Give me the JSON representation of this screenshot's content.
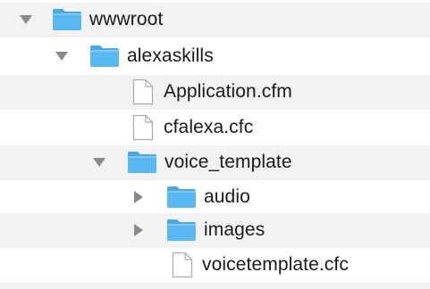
{
  "tree": {
    "items": [
      {
        "label": "wwwroot",
        "kind": "folder",
        "depth": 0,
        "expanded": true,
        "icon": "folder-icon",
        "arrow": "disclosure-expanded-icon"
      },
      {
        "label": "alexaskills",
        "kind": "folder",
        "depth": 1,
        "expanded": true,
        "icon": "folder-icon",
        "arrow": "disclosure-expanded-icon"
      },
      {
        "label": "Application.cfm",
        "kind": "file",
        "depth": 2,
        "icon": "document-icon"
      },
      {
        "label": "cfalexa.cfc",
        "kind": "file",
        "depth": 2,
        "icon": "document-icon"
      },
      {
        "label": "voice_template",
        "kind": "folder",
        "depth": 2,
        "expanded": true,
        "icon": "folder-icon",
        "arrow": "disclosure-expanded-icon"
      },
      {
        "label": "audio",
        "kind": "folder",
        "depth": 3,
        "expanded": false,
        "icon": "folder-icon",
        "arrow": "disclosure-collapsed-icon"
      },
      {
        "label": "images",
        "kind": "folder",
        "depth": 3,
        "expanded": false,
        "icon": "folder-icon",
        "arrow": "disclosure-collapsed-icon"
      },
      {
        "label": "voicetemplate.cfc",
        "kind": "file",
        "depth": 3,
        "icon": "document-icon"
      }
    ]
  },
  "colors": {
    "folder_body": "#5ab8f0",
    "folder_tab": "#4aa8e3",
    "row_stripe": "#f2f2f2",
    "disclosure": "#8a8a8a",
    "text": "#1a1a1a"
  }
}
